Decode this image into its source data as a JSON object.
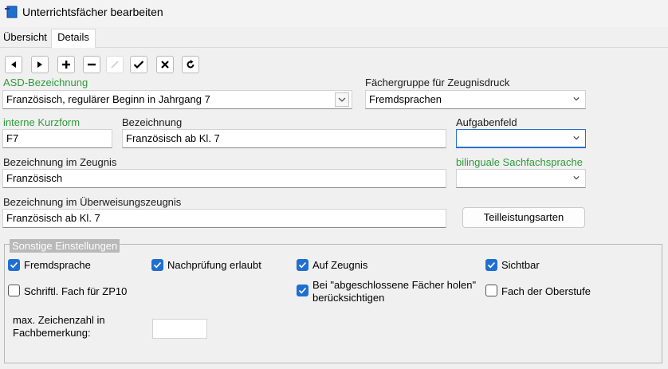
{
  "window": {
    "title": "Unterrichtsfächer bearbeiten"
  },
  "tabs": [
    {
      "label": "Übersicht"
    },
    {
      "label": "Details"
    }
  ],
  "toolbar": {
    "buttons": [
      {
        "name": "prev-button",
        "glyph": "◀"
      },
      {
        "name": "next-button",
        "glyph": "▶"
      },
      {
        "name": "add-button",
        "glyph": "+"
      },
      {
        "name": "remove-button",
        "glyph": "−"
      },
      {
        "name": "edit-button",
        "glyph": "∕"
      },
      {
        "name": "confirm-button",
        "glyph": "✓"
      },
      {
        "name": "cancel-button",
        "glyph": "✕"
      },
      {
        "name": "refresh-button",
        "glyph": "↻"
      }
    ]
  },
  "form": {
    "asd": {
      "label": "ASD-Bezeichnung",
      "value": "Französisch, regulärer Beginn in Jahrgang 7"
    },
    "faechergruppe": {
      "label": "Fächergruppe für Zeugnisdruck",
      "value": "Fremdsprachen"
    },
    "kurzform": {
      "label": "interne Kurzform",
      "value": "F7"
    },
    "bezeichnung": {
      "label": "Bezeichnung",
      "value": "Französisch ab Kl. 7"
    },
    "aufgabenfeld": {
      "label": "Aufgabenfeld",
      "value": ""
    },
    "zeugnis": {
      "label": "Bezeichnung im Zeugnis",
      "value": "Französisch"
    },
    "bilingual": {
      "label": "bilinguale Sachfachsprache",
      "value": ""
    },
    "ueberweisung": {
      "label": "Bezeichnung im Überweisungszeugnis",
      "value": "Französisch ab Kl. 7"
    },
    "teilleistungen_button": "Teilleistungsarten"
  },
  "settings": {
    "title": "Sonstige Einstellungen",
    "checkboxes": {
      "fremdsprache": {
        "label": "Fremdsprache",
        "checked": true
      },
      "nachpruefung": {
        "label": "Nachprüfung erlaubt",
        "checked": true
      },
      "aufzeugnis": {
        "label": "Auf Zeugnis",
        "checked": true
      },
      "sichtbar": {
        "label": "Sichtbar",
        "checked": true
      },
      "zp10": {
        "label": "Schriftl. Fach für ZP10",
        "checked": false
      },
      "abgeschlossen": {
        "label_line1": "Bei \"abgeschlossene Fächer holen\"",
        "label_line2": "berücksichtigen",
        "checked": true
      },
      "oberstufe": {
        "label": "Fach der Oberstufe",
        "checked": false
      }
    },
    "max_zeichen": {
      "label_line1": "max. Zeichenzahl in",
      "label_line2": "Fachbemerkung:",
      "value": ""
    }
  },
  "colors": {
    "accent": "#1f6fd0",
    "required_label": "#2e9b3a"
  }
}
